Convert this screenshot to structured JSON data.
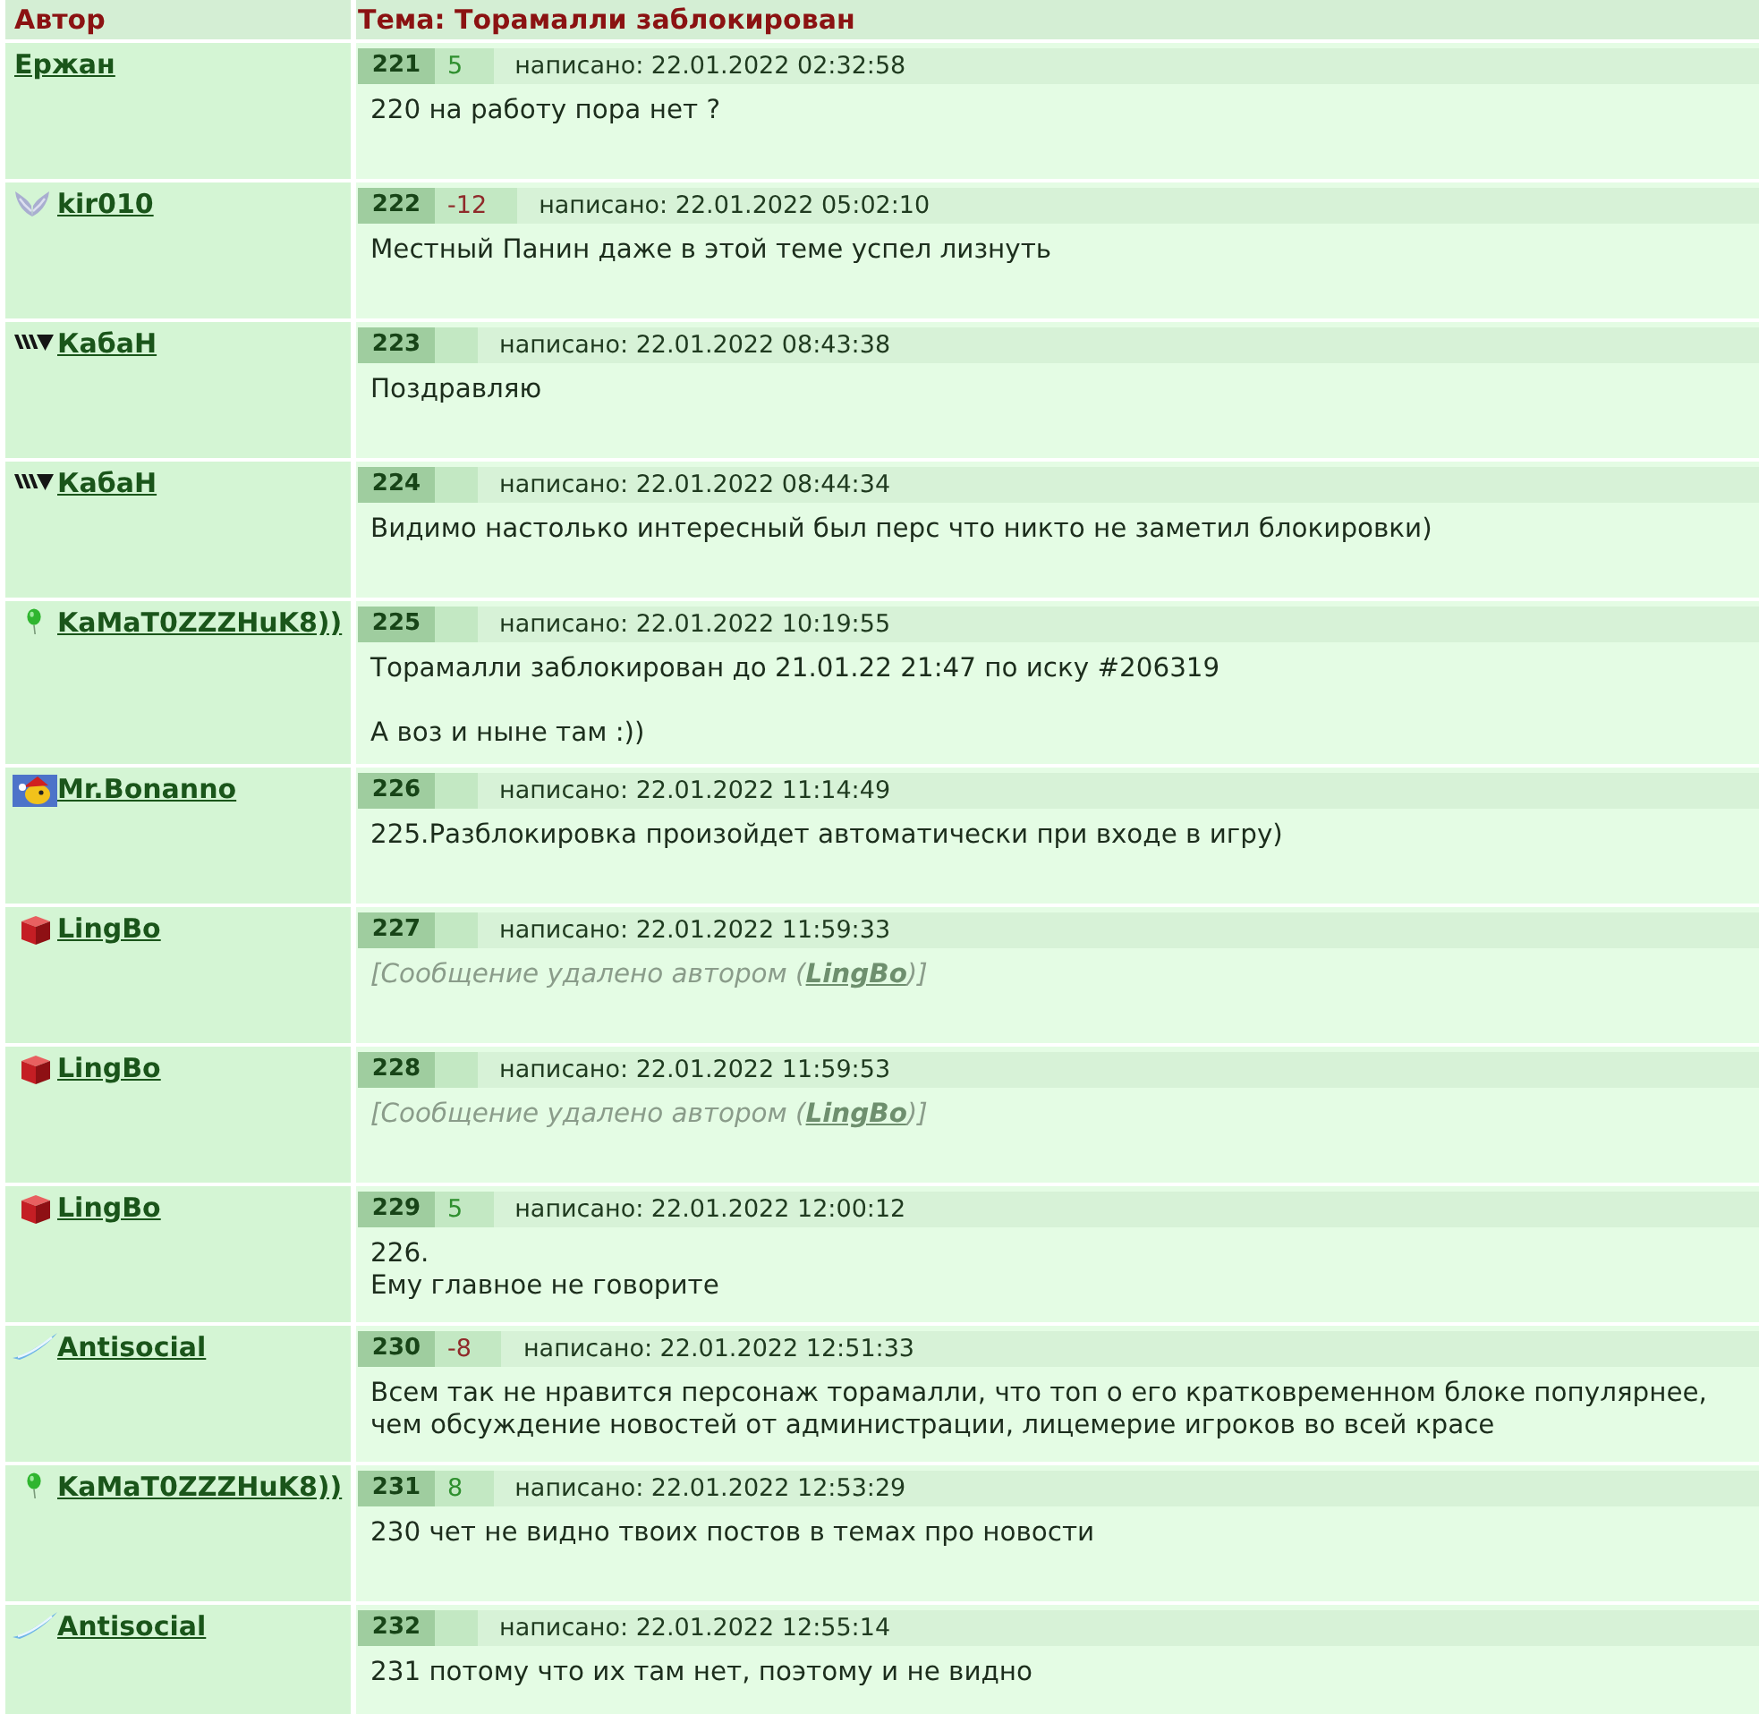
{
  "header": {
    "author_column": "Автор",
    "topic": "Тема: Торамалли заблокирован"
  },
  "posts": [
    {
      "author": {
        "name": "Ержан"
      },
      "number": "221",
      "score": {
        "text": "5",
        "color": "#2f8f2f"
      },
      "date": "написано: 22.01.2022 02:32:58",
      "message": {
        "kind": "text",
        "text": "220 на работу пора нет ?"
      }
    },
    {
      "author": {
        "name": "kir010",
        "kind": "wings"
      },
      "number": "222",
      "score": {
        "text": "-12",
        "color": "#8f2a2a"
      },
      "date": "написано: 22.01.2022 05:02:10",
      "message": {
        "kind": "text",
        "text": "Местный Панин даже в этой теме успел лизнуть"
      }
    },
    {
      "author": {
        "name": "КабаН",
        "kind": "emblem"
      },
      "number": "223",
      "date": "написано: 22.01.2022 08:43:38",
      "message": {
        "kind": "text",
        "text": "Поздравляю"
      }
    },
    {
      "author": {
        "name": "КабаН",
        "kind": "emblem"
      },
      "number": "224",
      "date": "написано: 22.01.2022 08:44:34",
      "message": {
        "kind": "text",
        "text": "Видимо настолько интересный был перс что никто не заметил блокировки)"
      }
    },
    {
      "author": {
        "name": "KaMaT0ZZZHuK8))",
        "kind": "balloon"
      },
      "number": "225",
      "date": "написано: 22.01.2022 10:19:55",
      "message": {
        "kind": "text",
        "text": "Торамалли заблокирован до 21.01.22 21:47 по иску #206319\n\nА воз и ныне там :))"
      }
    },
    {
      "author": {
        "name": "Mr.Bonanno",
        "kind": "avatar"
      },
      "number": "226",
      "date": "написано: 22.01.2022 11:14:49",
      "message": {
        "kind": "text",
        "text": "225.Разблокировка произойдет автоматически при входе в игру)"
      }
    },
    {
      "author": {
        "name": "LingBo",
        "kind": "cube"
      },
      "number": "227",
      "date": "написано: 22.01.2022 11:59:33",
      "message": {
        "kind": "deleted",
        "before": "[Сообщение удалено автором (",
        "link": "LingBo",
        "after": ")]"
      }
    },
    {
      "author": {
        "name": "LingBo",
        "kind": "cube"
      },
      "number": "228",
      "date": "написано: 22.01.2022 11:59:53",
      "message": {
        "kind": "deleted",
        "before": "[Сообщение удалено автором (",
        "link": "LingBo",
        "after": ")]"
      }
    },
    {
      "author": {
        "name": "LingBo",
        "kind": "cube"
      },
      "number": "229",
      "score": {
        "text": "5",
        "color": "#2f8f2f"
      },
      "date": "написано: 22.01.2022 12:00:12",
      "message": {
        "kind": "text",
        "text": "226.\nЕму главное не говорите"
      }
    },
    {
      "author": {
        "name": "Antisocial",
        "kind": "streak"
      },
      "number": "230",
      "score": {
        "text": "-8",
        "color": "#8f2a2a"
      },
      "date": "написано: 22.01.2022 12:51:33",
      "message": {
        "kind": "text",
        "text": "Всем так не нравится персонаж торамалли, что топ о его кратковременном блоке популярнее,\nчем обсуждение новостей от администрации, лицемерие игроков во всей красе"
      }
    },
    {
      "author": {
        "name": "KaMaT0ZZZHuK8))",
        "kind": "balloon"
      },
      "number": "231",
      "score": {
        "text": "8",
        "color": "#2f8f2f"
      },
      "date": "написано: 22.01.2022 12:53:29",
      "message": {
        "kind": "text",
        "text": "230 чет не видно твоих постов в темах про новости"
      }
    },
    {
      "author": {
        "name": "Antisocial",
        "kind": "streak"
      },
      "number": "232",
      "date": "написано: 22.01.2022 12:55:14",
      "message": {
        "kind": "text",
        "text": "231 потому что их там нет, поэтому и не видно"
      }
    }
  ]
}
